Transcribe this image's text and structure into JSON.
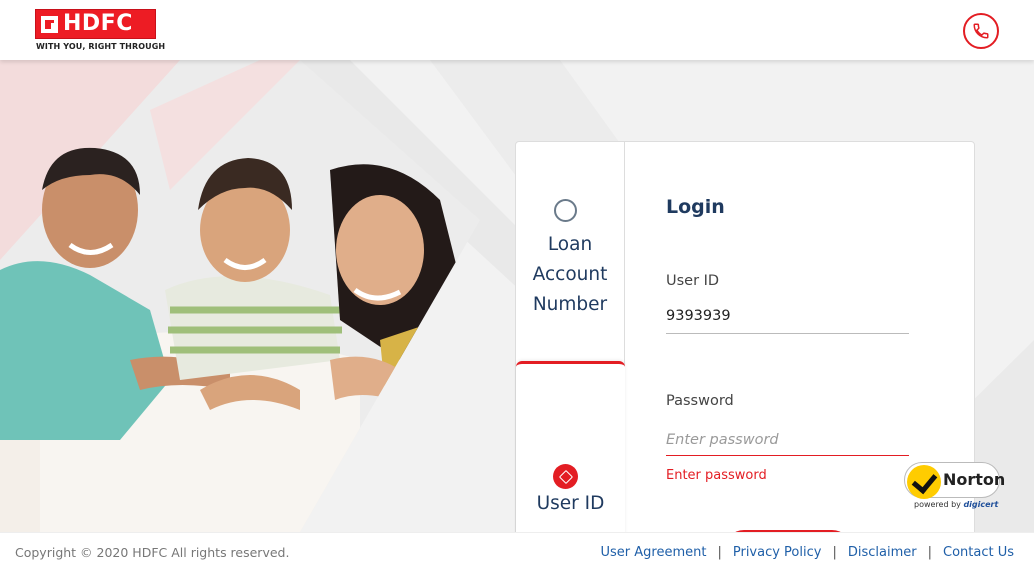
{
  "brand": {
    "name": "HDFC",
    "tagline": "WITH YOU, RIGHT THROUGH",
    "red": "#e31d23",
    "navy": "#1f3a5f"
  },
  "header": {
    "call_icon": "phone-icon"
  },
  "hero": {
    "image": "family-photo"
  },
  "login_card": {
    "tabs": [
      {
        "label": "Loan Account Number",
        "selected": false
      },
      {
        "label": "User ID",
        "selected": true
      }
    ],
    "title": "Login",
    "user_id_label": "User ID",
    "user_id_value": "9393939",
    "password_label": "Password",
    "password_placeholder": "Enter password",
    "password_error": "Enter password"
  },
  "norton_badge": {
    "name": "Norton",
    "powered_by": "powered by",
    "provider": "digicert"
  },
  "footer": {
    "copyright": "Copyright © 2020 HDFC All rights reserved.",
    "links": [
      "User Agreement",
      "Privacy Policy",
      "Disclaimer",
      "Contact Us"
    ],
    "separator": "|"
  }
}
